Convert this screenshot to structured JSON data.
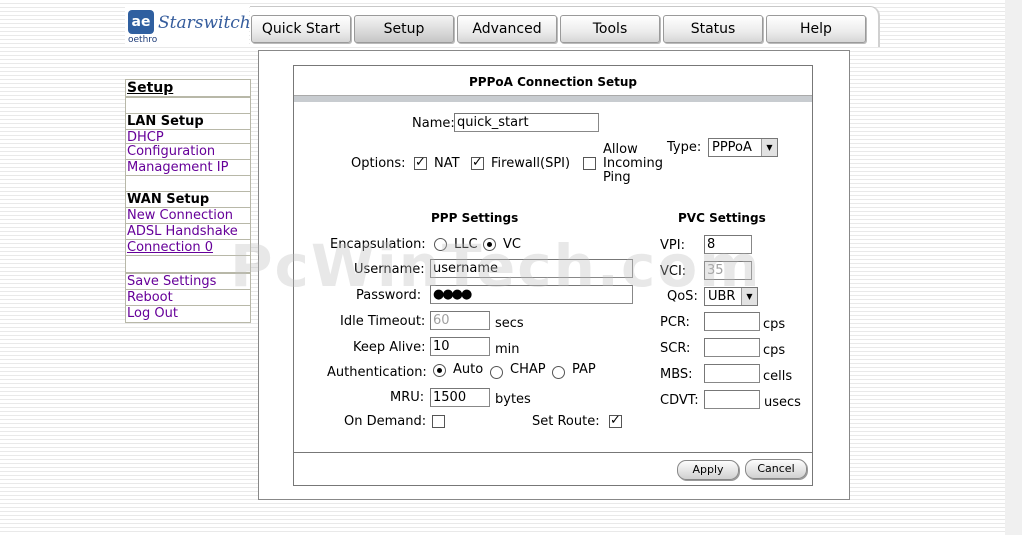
{
  "brand": {
    "mark": "ae",
    "sub": "oethro",
    "name": "Starswitch"
  },
  "nav": {
    "tabs": [
      "Quick Start",
      "Setup",
      "Advanced",
      "Tools",
      "Status",
      "Help"
    ]
  },
  "sidebar": {
    "title": "Setup",
    "lan_header": "LAN Setup",
    "dhcp_line1": "DHCP",
    "dhcp_line2": "Configuration",
    "management_ip": "Management IP",
    "wan_header": "WAN Setup",
    "new_connection": "New Connection",
    "adsl_handshake": "ADSL Handshake",
    "connection0": "Connection 0",
    "save_settings": "Save Settings",
    "reboot": "Reboot",
    "logout": "Log Out"
  },
  "form": {
    "title": "PPPoA Connection Setup",
    "name_label": "Name:",
    "name_value": "quick_start",
    "options_label": "Options:",
    "nat_label": "NAT",
    "firewall_label": "Firewall(SPI)",
    "allow_ping_line1": "Allow",
    "allow_ping_line2": "Incoming",
    "allow_ping_line3": "Ping",
    "type_label": "Type:",
    "type_value": "PPPoA",
    "ppp_settings": "PPP Settings",
    "pvc_settings": "PVC Settings",
    "encapsulation_label": "Encapsulation:",
    "llc_label": "LLC",
    "vc_label": "VC",
    "username_label": "Username:",
    "username_value": "username",
    "password_label": "Password:",
    "password_value": "●●●●",
    "idle_timeout_label": "Idle Timeout:",
    "idle_timeout_value": "60",
    "idle_timeout_unit": "secs",
    "keep_alive_label": "Keep Alive:",
    "keep_alive_value": "10",
    "keep_alive_unit": "min",
    "auth_label": "Authentication:",
    "auth_auto": "Auto",
    "auth_chap": "CHAP",
    "auth_pap": "PAP",
    "mru_label": "MRU:",
    "mru_value": "1500",
    "mru_unit": "bytes",
    "on_demand_label": "On Demand:",
    "set_route_label": "Set Route:",
    "vpi_label": "VPI:",
    "vpi_value": "8",
    "vci_label": "VCI:",
    "vci_value": "35",
    "qos_label": "QoS:",
    "qos_value": "UBR",
    "pcr_label": "PCR:",
    "pcr_unit": "cps",
    "scr_label": "SCR:",
    "scr_unit": "cps",
    "mbs_label": "MBS:",
    "mbs_unit": "cells",
    "cdvt_label": "CDVT:",
    "cdvt_unit": "usecs",
    "apply": "Apply",
    "cancel": "Cancel",
    "check_mark": "✓"
  },
  "watermark": "PcWinTech.com"
}
